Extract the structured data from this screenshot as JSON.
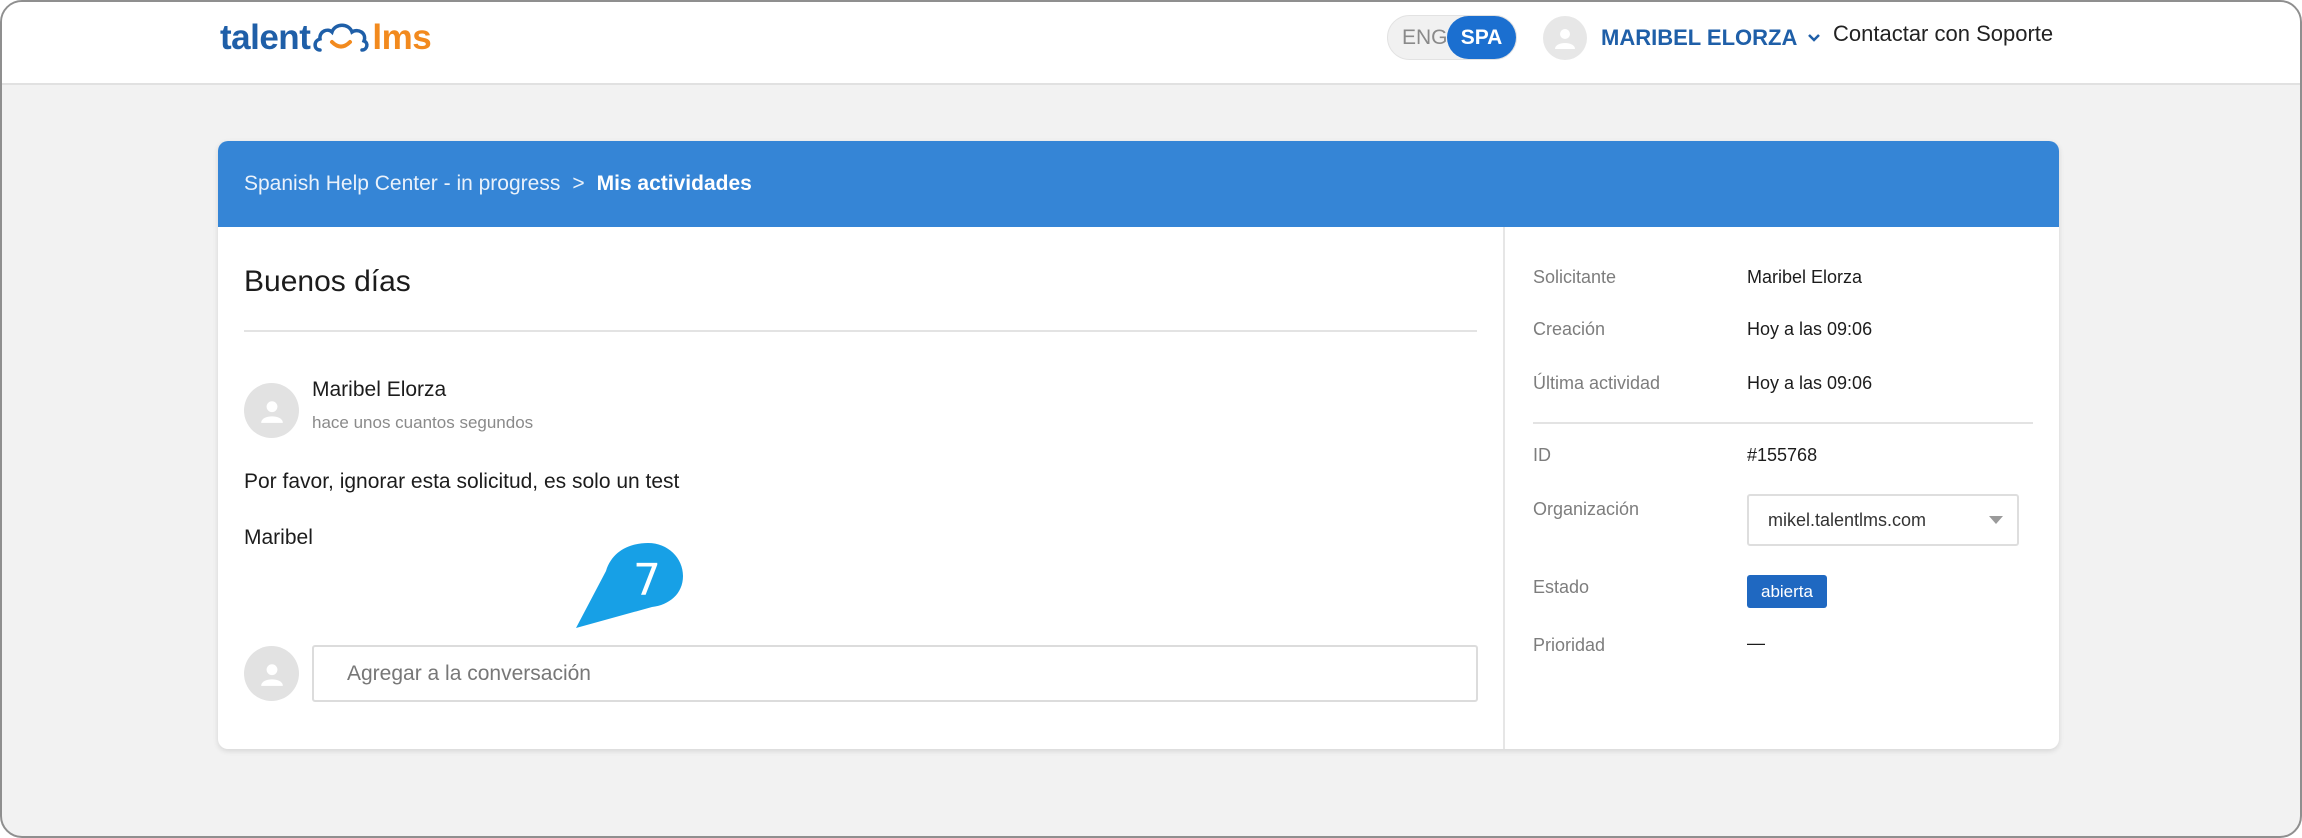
{
  "header": {
    "logo": {
      "part1": "talent",
      "part2": "lms",
      "icon": "cloud-smile-icon"
    },
    "languages": {
      "eng": "ENG",
      "spa": "SPA",
      "active": "SPA"
    },
    "user_name": "MARIBEL ELORZA",
    "support_link": "Contactar con Soporte"
  },
  "breadcrumb": {
    "parent": "Spanish Help Center - in progress",
    "separator": ">",
    "current": "Mis actividades"
  },
  "ticket": {
    "title": "Buenos días",
    "message": {
      "author": "Maribel Elorza",
      "time": "hace unos cuantos segundos",
      "lines": [
        "Por favor, ignorar esta solicitud, es solo un test",
        "Maribel"
      ]
    },
    "reply_placeholder": "Agregar a la conversación"
  },
  "details": {
    "requester": {
      "label": "Solicitante",
      "value": "Maribel Elorza"
    },
    "created": {
      "label": "Creación",
      "value": "Hoy a las 09:06"
    },
    "last_activity": {
      "label": "Última actividad",
      "value": "Hoy a las 09:06"
    },
    "id": {
      "label": "ID",
      "value": "#155768"
    },
    "organization": {
      "label": "Organización",
      "value": "mikel.talentlms.com"
    },
    "status": {
      "label": "Estado",
      "value": "abierta"
    },
    "priority": {
      "label": "Prioridad",
      "value": "—"
    }
  },
  "callout": {
    "number": "7"
  },
  "colors": {
    "brand_blue": "#1f5fa8",
    "brand_orange": "#f28a1e",
    "header_bar": "#3585d6",
    "active_lang": "#1b6fd0",
    "status_badge": "#1f68c1",
    "callout": "#17a0e6"
  }
}
